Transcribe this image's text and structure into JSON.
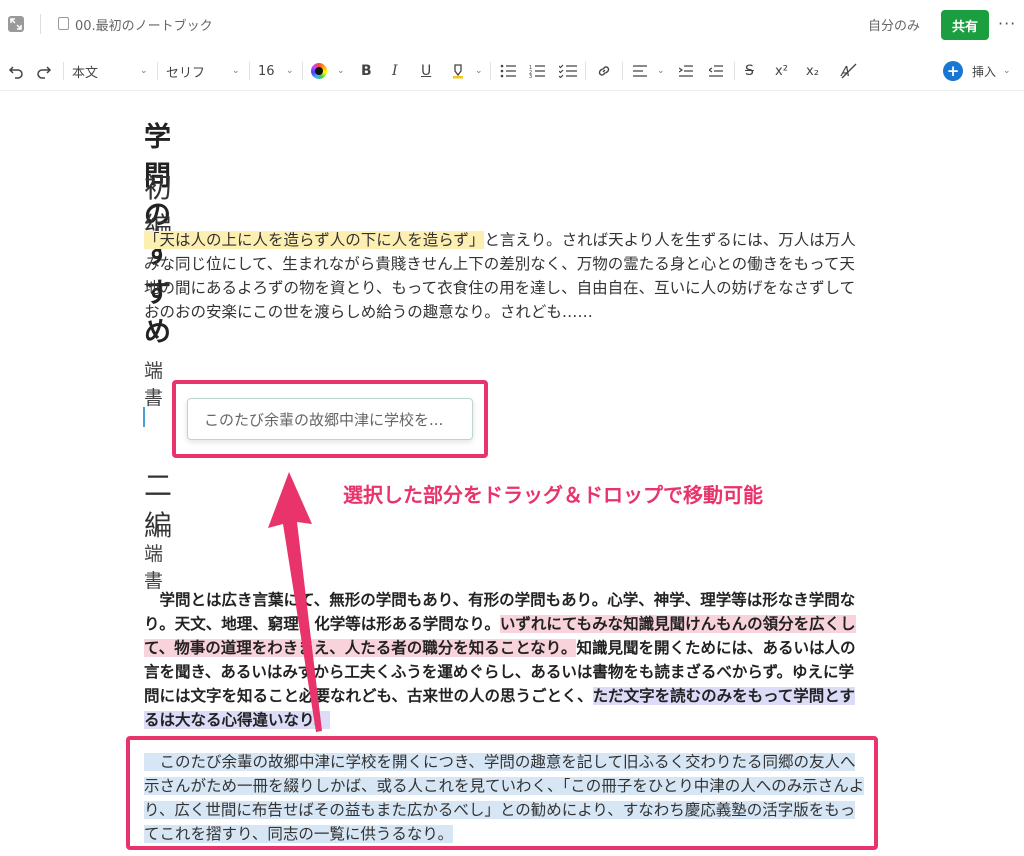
{
  "header": {
    "notebook_title": "00.最初のノートブック",
    "share_scope": "自分のみ",
    "share_button": "共有",
    "more": "···"
  },
  "toolbar": {
    "style": "本文",
    "font": "セリフ",
    "size": "16",
    "bold": "B",
    "italic": "I",
    "underline": "U",
    "superscript": "x²",
    "subscript": "x₂",
    "insert": "挿入"
  },
  "document": {
    "title": "学問のすすめ",
    "section1": "初編",
    "p1_highlight": "「天は人の上に人を造らず人の下に人を造らず」",
    "p1_rest": "と言えり。されば天より人を生ずるには、万人は万人みな同じ位にして、生まれながら貴賤きせん上下の差別なく、万物の霊たる身と心との働きをもって天地の間にあるよろずの物を資とり、もって衣食住の用を達し、自由自在、互いに人の妨げをなさずしておのおの安楽にこの世を渡らしめ給うの趣意なり。されども……",
    "sub1": "端書",
    "drag_chip": "このたび余輩の故郷中津に学校を...",
    "section2": "二編",
    "sub2": "端書",
    "p2_a": "　学問とは広き言葉にて、無形の学問もあり、有形の学問もあり。心学、神学、理学等は形なき学問なり。天文、地理、窮理、化学等は形ある学問なり。",
    "p2_pink": "いずれにてもみな知識見聞けんもんの領分を広くして、物事の道理をわきまえ、人たる者の職分を知ることなり。",
    "p2_b": "知識見聞を開くためには、あるいは人の言を聞き、あるいはみずから工夫くふうを運めぐらし、あるいは書物をも読まざるべからず。ゆえに学問には文字を知ること必要なれども、古来世の人の思うごとく、",
    "p2_purple": "ただ文字を読むのみをもって学問とするは大なる心得違いなり。",
    "p3": "　このたび余輩の故郷中津に学校を開くにつき、学問の趣意を記して旧ふるく交わりたる同郷の友人へ示さんがため一冊を綴りしかば、或る人これを見ていわく、「この冊子をひとり中津の人へのみ示さんより、広く世間に布告せばその益もまた広かるべし」との勧めにより、すなわち慶応義塾の活字版をもってこれを摺すり、同志の一覧に供うるなり。"
  },
  "annotation": {
    "text": "選択した部分をドラッグ＆ドロップで移動可能",
    "color": "#e8336b"
  }
}
